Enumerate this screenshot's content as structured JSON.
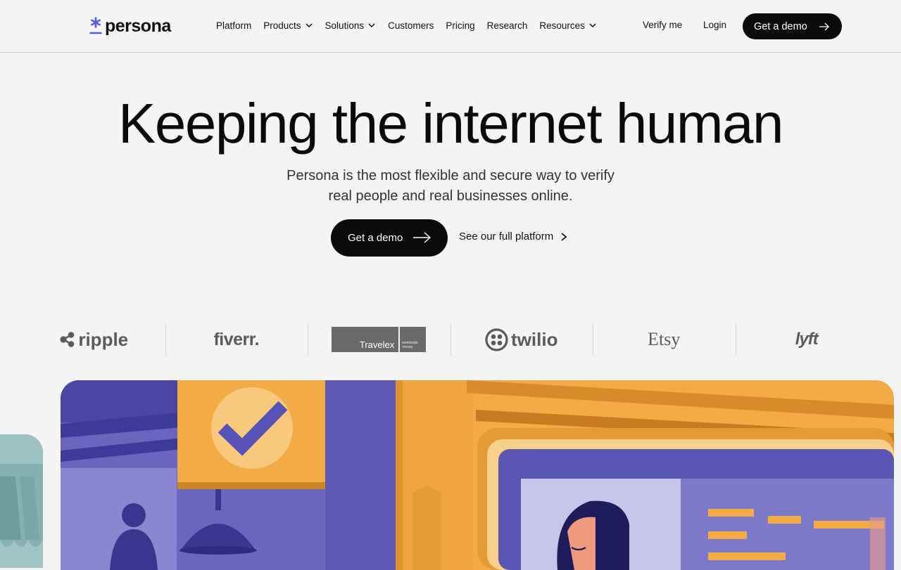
{
  "header": {
    "logo_text": "persona",
    "nav": [
      {
        "label": "Platform",
        "dropdown": false
      },
      {
        "label": "Products",
        "dropdown": true
      },
      {
        "label": "Solutions",
        "dropdown": true
      },
      {
        "label": "Customers",
        "dropdown": false
      },
      {
        "label": "Pricing",
        "dropdown": false
      },
      {
        "label": "Research",
        "dropdown": false
      },
      {
        "label": "Resources",
        "dropdown": true
      }
    ],
    "verify_label": "Verify me",
    "login_label": "Login",
    "demo_label": "Get a demo"
  },
  "hero": {
    "title": "Keeping the internet human",
    "subtitle": "Persona is the most flexible and secure way to verify real people and real businesses online.",
    "primary_cta": "Get a demo",
    "secondary_cta": "See our full platform"
  },
  "logos": {
    "ripple": "ripple",
    "fiverr": "fiverr.",
    "travelex": "Travelex",
    "travelex_tag": "worldwide money",
    "twilio": "twilio",
    "etsy": "Etsy",
    "lyft": "lyft"
  },
  "colors": {
    "accent": "#5f55e6",
    "button": "#0b0b0b",
    "background": "#f4f4f4",
    "illustration_purple": "#6a66bd",
    "illustration_orange": "#f2ab45"
  },
  "icons": [
    "persona-asterisk-icon",
    "chevron-down-icon",
    "arrow-right-icon",
    "chevron-right-icon",
    "checkmark-icon"
  ]
}
